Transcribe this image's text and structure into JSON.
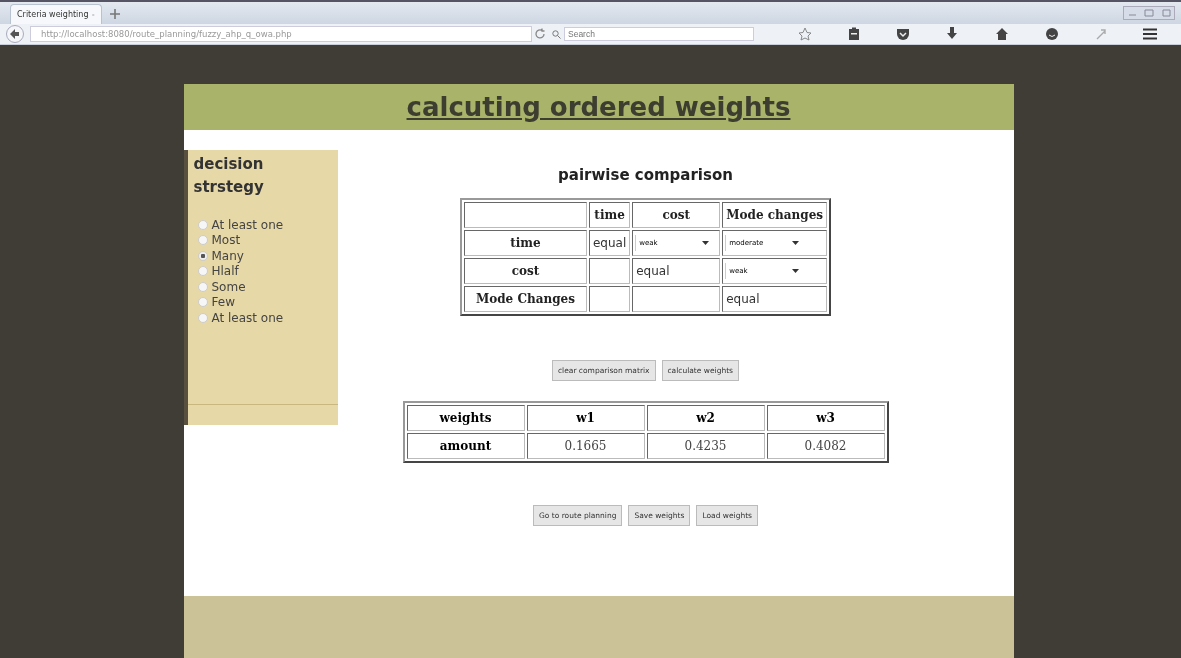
{
  "browser": {
    "tab_title": "Criteria weighting",
    "url": "http://localhost:8080/route_planning/fuzzy_ahp_q_owa.php",
    "search_placeholder": "Search"
  },
  "page": {
    "title": "calcuting ordered weights"
  },
  "sidebar": {
    "title": "decision strstegy",
    "options": [
      {
        "label": "At least one",
        "selected": false
      },
      {
        "label": "Most",
        "selected": false
      },
      {
        "label": "Many",
        "selected": true
      },
      {
        "label": "Hlalf",
        "selected": false
      },
      {
        "label": "Some",
        "selected": false
      },
      {
        "label": "Few",
        "selected": false
      },
      {
        "label": "At least one",
        "selected": false
      }
    ]
  },
  "comparison": {
    "title": "pairwise comparison",
    "columns": [
      "time",
      "cost",
      "Mode changes"
    ],
    "rows": [
      {
        "label": "time",
        "cells": [
          {
            "kind": "text",
            "value": "equal"
          },
          {
            "kind": "select",
            "value": "weak"
          },
          {
            "kind": "select",
            "value": "moderate"
          }
        ]
      },
      {
        "label": "cost",
        "cells": [
          {
            "kind": "empty"
          },
          {
            "kind": "text",
            "value": "equal"
          },
          {
            "kind": "select",
            "value": "weak"
          }
        ]
      },
      {
        "label": "Mode Changes",
        "cells": [
          {
            "kind": "empty"
          },
          {
            "kind": "empty"
          },
          {
            "kind": "text",
            "value": "equal"
          }
        ]
      }
    ]
  },
  "matrix_buttons": [
    "clear comparison matrix",
    "calculate weights"
  ],
  "weights": {
    "header": [
      "weights",
      "w1",
      "w2",
      "w3"
    ],
    "row": [
      "amount",
      "0.1665",
      "0.4235",
      "0.4082"
    ]
  },
  "buttons": [
    "Go to route planning",
    "Save weights",
    "Load weights"
  ]
}
